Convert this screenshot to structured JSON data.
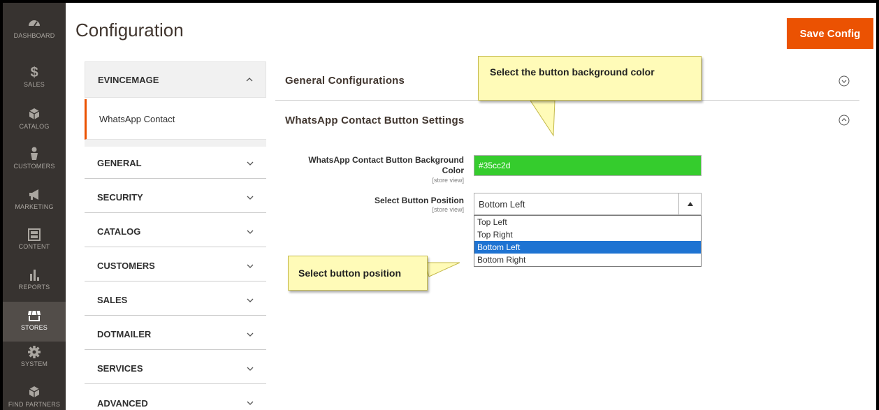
{
  "nav": {
    "items": [
      {
        "label": "Dashboard",
        "icon": "dashboard-icon"
      },
      {
        "label": "Sales",
        "icon": "dollar-icon"
      },
      {
        "label": "Catalog",
        "icon": "box-icon"
      },
      {
        "label": "Customers",
        "icon": "person-icon"
      },
      {
        "label": "Marketing",
        "icon": "megaphone-icon"
      },
      {
        "label": "Content",
        "icon": "content-icon"
      },
      {
        "label": "Reports",
        "icon": "bar-chart-icon"
      },
      {
        "label": "Stores",
        "icon": "store-icon"
      },
      {
        "label": "System",
        "icon": "gear-icon"
      },
      {
        "label": "Find Partners",
        "icon": "partners-icon"
      }
    ]
  },
  "header": {
    "title": "Configuration",
    "save_label": "Save Config"
  },
  "tabs": {
    "evincemage": "EVINCEMAGE",
    "whatsapp_item": "WhatsApp Contact",
    "groups": [
      "GENERAL",
      "SECURITY",
      "CATALOG",
      "CUSTOMERS",
      "SALES",
      "DOTMAILER",
      "SERVICES",
      "ADVANCED"
    ]
  },
  "main": {
    "section1": "General Configurations",
    "section2": "WhatsApp Contact Button Settings",
    "bg_color_label_line1": "WhatsApp Contact Button Background",
    "bg_color_label_line2": "Color",
    "scope": "[store view]",
    "bg_color_value": "#35cc2d",
    "position_label": "Select Button Position",
    "position_selected": "Bottom Left",
    "position_options": [
      "Top Left",
      "Top Right",
      "Bottom Left",
      "Bottom Right"
    ]
  },
  "callouts": {
    "color": "Select the button background color",
    "position": "Select button position"
  },
  "colors": {
    "accent": "#eb5202",
    "nav_bg": "#373330",
    "selected_option": "#1e73d2",
    "callout_bg": "#fffbb8"
  }
}
